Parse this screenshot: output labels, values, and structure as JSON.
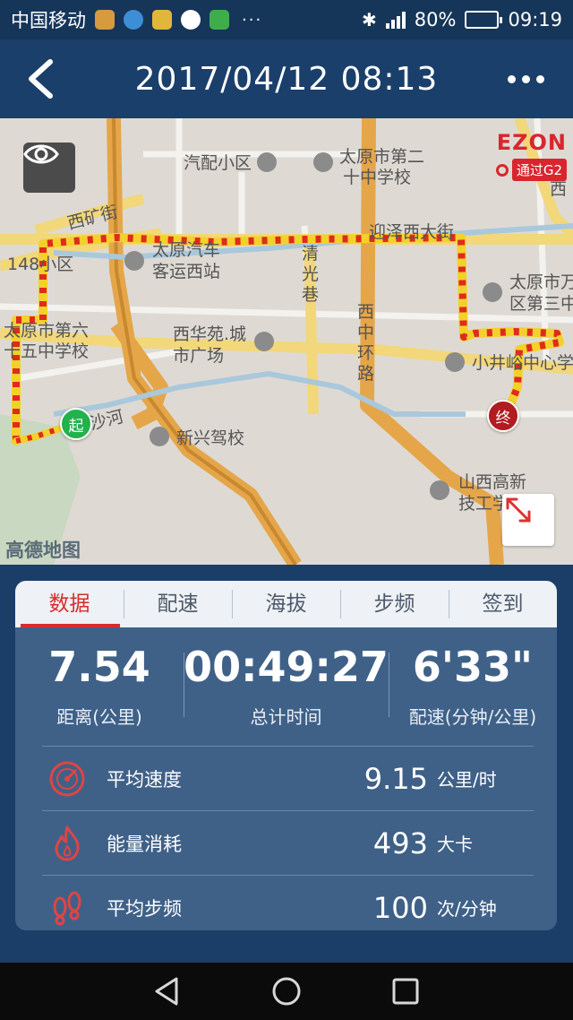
{
  "status_bar": {
    "carrier": "中国移动",
    "dots": "···",
    "battery": "80%",
    "battery_level": 0.8,
    "time": "09:19"
  },
  "header": {
    "title": "2017/04/12 08:13"
  },
  "map": {
    "labels": {
      "qipei": "汽配小区",
      "taiyuan2_l1": "太原市第二",
      "taiyuan2_l2": "十中学校",
      "xikuangjie": "西矿街",
      "qiao148": "148小区",
      "bus_l1": "太原汽车",
      "bus_l2": "客运西站",
      "qingguang_l1": "清",
      "qingguang_l2": "光",
      "qingguang_l3": "巷",
      "yingze": "迎泽西大街",
      "taiyuan65_l1": "太原市第六",
      "taiyuan65_l2": "十五中学校",
      "xihuayuan_l1": "西华苑.城",
      "xihuayuan_l2": "市广场",
      "xizhong_l1": "西",
      "xizhong_l2": "中",
      "xizhong_l3": "环",
      "xizhong_l4": "路",
      "taiyuanr_l1": "太原市万",
      "taiyuanr_l2": "区第三中",
      "xiaojing": "小井峪中心学",
      "xinxing": "新兴驾校",
      "shahe": "沙河",
      "shanxi_l1": "山西高新",
      "shanxi_l2": "技工学",
      "xi_right": "西"
    },
    "brand": "EZON",
    "badge": "通过G2",
    "watermark": "高德地图",
    "start_marker": "起",
    "end_marker": "终"
  },
  "tabs": [
    "数据",
    "配速",
    "海拔",
    "步频",
    "签到"
  ],
  "summary": [
    {
      "value": "7.54",
      "label": "距离(公里)"
    },
    {
      "value": "00:49:27",
      "label": "总计时间"
    },
    {
      "value": "6'33\"",
      "label": "配速(分钟/公里)"
    }
  ],
  "metrics": [
    {
      "icon": "speedometer-icon",
      "label": "平均速度",
      "value": "9.15",
      "unit": "公里/时"
    },
    {
      "icon": "flame-icon",
      "label": "能量消耗",
      "value": "493",
      "unit": "大卡"
    },
    {
      "icon": "footprint-icon",
      "label": "平均步频",
      "value": "100",
      "unit": "次/分钟"
    }
  ],
  "colors": {
    "accent": "#d82c2c",
    "header": "#1a3f6b",
    "card": "#3f6188",
    "route_start": "#f4d12a",
    "route_hot": "#e02a1f"
  }
}
